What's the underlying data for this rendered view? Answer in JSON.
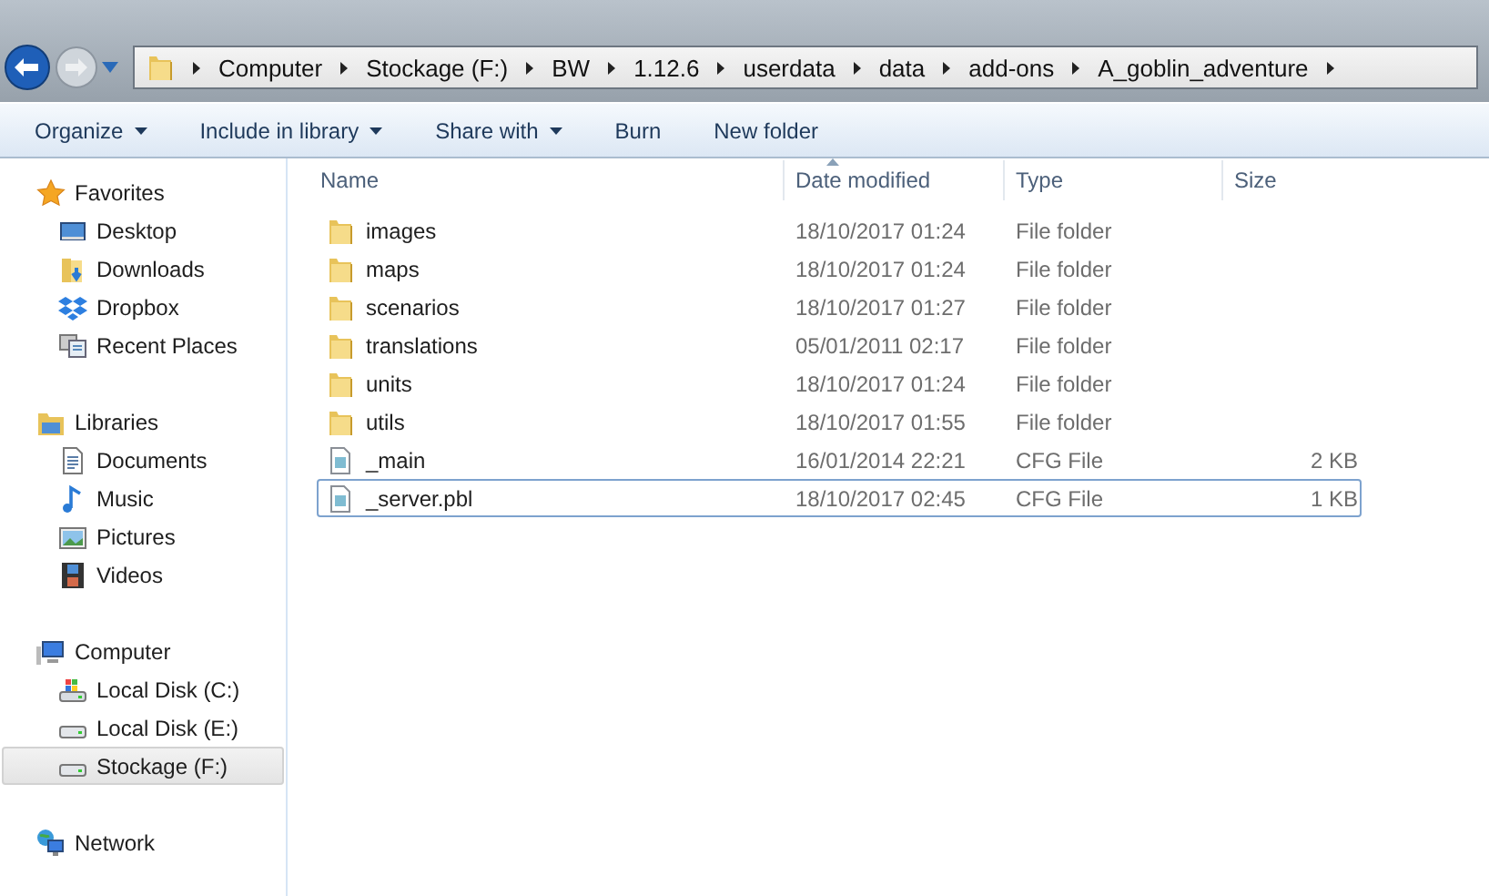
{
  "address_bar": {
    "crumbs": [
      "Computer",
      "Stockage (F:)",
      "BW",
      "1.12.6",
      "userdata",
      "data",
      "add-ons",
      "A_goblin_adventure"
    ]
  },
  "toolbar": {
    "buttons": [
      {
        "label": "Organize",
        "dropdown": true
      },
      {
        "label": "Include in library",
        "dropdown": true
      },
      {
        "label": "Share with",
        "dropdown": true
      },
      {
        "label": "Burn",
        "dropdown": false
      },
      {
        "label": "New folder",
        "dropdown": false
      }
    ]
  },
  "sidebar": {
    "groups": [
      {
        "label": "Favorites",
        "kind": "star",
        "items": [
          {
            "label": "Desktop",
            "kind": "desktop",
            "selected": false
          },
          {
            "label": "Downloads",
            "kind": "downloads",
            "selected": false
          },
          {
            "label": "Dropbox",
            "kind": "dropbox",
            "selected": false
          },
          {
            "label": "Recent Places",
            "kind": "recent",
            "selected": false
          }
        ]
      },
      {
        "label": "Libraries",
        "kind": "libraries",
        "items": [
          {
            "label": "Documents",
            "kind": "documents",
            "selected": false
          },
          {
            "label": "Music",
            "kind": "music",
            "selected": false
          },
          {
            "label": "Pictures",
            "kind": "pictures",
            "selected": false
          },
          {
            "label": "Videos",
            "kind": "videos",
            "selected": false
          }
        ]
      },
      {
        "label": "Computer",
        "kind": "computer",
        "items": [
          {
            "label": "Local Disk (C:)",
            "kind": "system-disk",
            "selected": false
          },
          {
            "label": "Local Disk (E:)",
            "kind": "disk",
            "selected": false
          },
          {
            "label": "Stockage (F:)",
            "kind": "disk",
            "selected": true
          }
        ]
      },
      {
        "label": "Network",
        "kind": "network"
      }
    ]
  },
  "table": {
    "columns": [
      "Name",
      "Date modified",
      "Type",
      "Size"
    ],
    "rows": [
      {
        "kind": "folder",
        "name": "images",
        "date": "18/10/2017 01:24",
        "type": "File folder",
        "focused": false
      },
      {
        "kind": "folder",
        "name": "maps",
        "date": "18/10/2017 01:24",
        "type": "File folder",
        "focused": false
      },
      {
        "kind": "folder",
        "name": "scenarios",
        "date": "18/10/2017 01:27",
        "type": "File folder",
        "focused": false
      },
      {
        "kind": "folder",
        "name": "translations",
        "date": "05/01/2011 02:17",
        "type": "File folder",
        "focused": false
      },
      {
        "kind": "folder",
        "name": "units",
        "date": "18/10/2017 01:24",
        "type": "File folder",
        "focused": false
      },
      {
        "kind": "folder",
        "name": "utils",
        "date": "18/10/2017 01:55",
        "type": "File folder",
        "focused": false
      },
      {
        "kind": "file",
        "name": "_main",
        "date": "16/01/2014 22:21",
        "type": "CFG File",
        "size": "2 KB",
        "focused": false
      },
      {
        "kind": "file",
        "name": "_server.pbl",
        "date": "18/10/2017 02:45",
        "type": "CFG File",
        "size": "1 KB",
        "focused": true
      }
    ]
  }
}
